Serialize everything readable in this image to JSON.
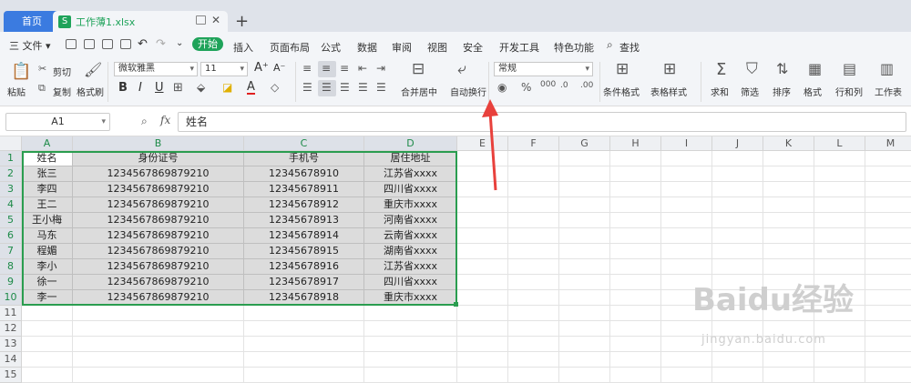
{
  "tabs": {
    "home": "首页",
    "file_name": "工作薄1.xlsx",
    "file_badge": "S",
    "new_tab": "+"
  },
  "menu": {
    "file": "三 文件 ▾",
    "start": "开始",
    "items": [
      "插入",
      "页面布局",
      "公式",
      "数据",
      "审阅",
      "视图",
      "安全",
      "开发工具",
      "特色功能",
      "查找"
    ]
  },
  "ribbon": {
    "paste": "粘贴",
    "cut": "剪切",
    "copy": "复制",
    "format_painter": "格式刷",
    "font_name": "微软雅黑",
    "font_size": "11",
    "merge_center": "合并居中",
    "wrap_text": "自动换行",
    "number_format": "常规",
    "conditional_format": "条件格式",
    "table_style": "表格样式",
    "sum": "求和",
    "filter": "筛选",
    "sort": "排序",
    "format": "格式",
    "row_col": "行和列",
    "worksheet": "工作表"
  },
  "formula_bar": {
    "cell_ref": "A1",
    "fx": "fx",
    "value": "姓名"
  },
  "sheet": {
    "columns": [
      "A",
      "B",
      "C",
      "D",
      "E",
      "F",
      "G",
      "H",
      "I",
      "J",
      "K",
      "L",
      "M"
    ],
    "rows": [
      "1",
      "2",
      "3",
      "4",
      "5",
      "6",
      "7",
      "8",
      "9",
      "10",
      "11",
      "12",
      "13",
      "14",
      "15"
    ],
    "table": [
      [
        "姓名",
        "身份证号",
        "手机号",
        "居住地址"
      ],
      [
        "张三",
        "1234567869879210",
        "12345678910",
        "江苏省xxxx"
      ],
      [
        "李四",
        "1234567869879210",
        "12345678911",
        "四川省xxxx"
      ],
      [
        "王二",
        "1234567869879210",
        "12345678912",
        "重庆市xxxx"
      ],
      [
        "王小梅",
        "1234567869879210",
        "12345678913",
        "河南省xxxx"
      ],
      [
        "马东",
        "1234567869879210",
        "12345678914",
        "云南省xxxx"
      ],
      [
        "程媚",
        "1234567869879210",
        "12345678915",
        "湖南省xxxx"
      ],
      [
        "李小",
        "1234567869879210",
        "12345678916",
        "江苏省xxxx"
      ],
      [
        "徐一",
        "1234567869879210",
        "12345678917",
        "四川省xxxx"
      ],
      [
        "李一",
        "1234567869879210",
        "12345678918",
        "重庆市xxxx"
      ]
    ]
  },
  "watermark": {
    "main": "Baidu经验",
    "sub": "jingyan.baidu.com"
  },
  "colors": {
    "accent": "#1fa35a",
    "selection": "#2a9d4f",
    "arrow": "#e8413c",
    "home_tab": "#3b7be0"
  }
}
